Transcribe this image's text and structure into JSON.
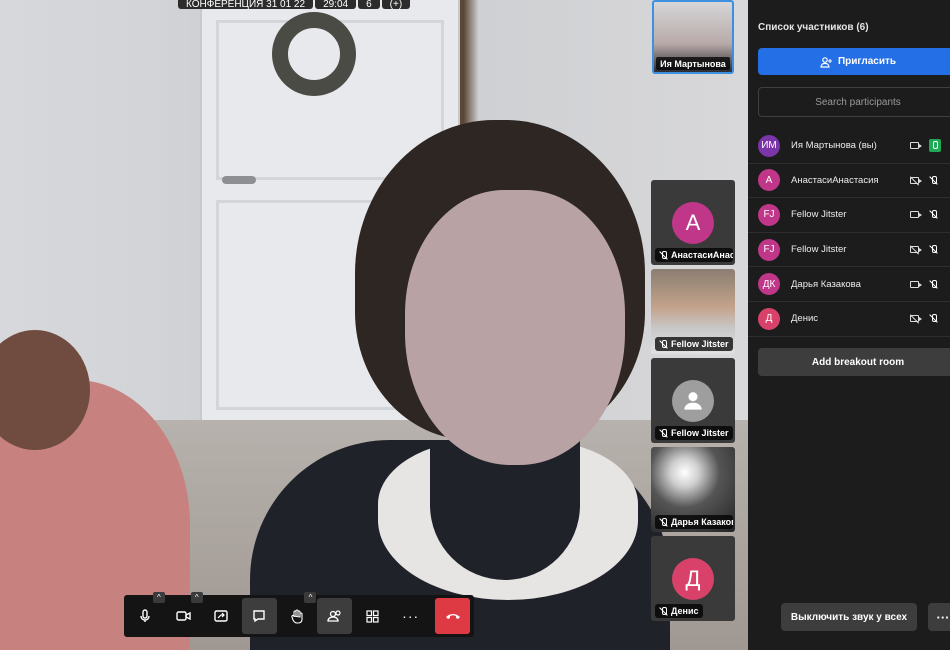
{
  "topbar": {
    "meeting_title": "КОНФЕРЕНЦИЯ 31 01 22",
    "timer": "29:04",
    "badge_count": "6",
    "extra": "(+)"
  },
  "self_view": {
    "name": "Ия Мартынова"
  },
  "filmstrip": [
    {
      "initial": "А",
      "name": "АнастасиАнастасия",
      "color": "#c0378a"
    },
    {
      "initial": "",
      "name": "Fellow Jitster",
      "color": "#888888"
    },
    {
      "initial": "",
      "name": "Fellow Jitster",
      "color": "#9e9e9e"
    },
    {
      "initial": "",
      "name": "Дарья Казакова",
      "color": "#666666"
    },
    {
      "initial": "Д",
      "name": "Денис",
      "color": "#d8426a"
    }
  ],
  "toolbar": {
    "buttons": [
      "mic",
      "camera",
      "share-screen",
      "chat",
      "raise-hand",
      "participants",
      "tile-view",
      "more",
      "hangup"
    ]
  },
  "panel": {
    "title": "Список участников (6)",
    "invite_label": "Пригласить",
    "search_placeholder": "Search participants",
    "participants": [
      {
        "initials": "ИМ",
        "name": "Ия Мартынова (вы)",
        "color": "#7a35a8",
        "camera": "on",
        "mic": "on"
      },
      {
        "initials": "А",
        "name": "АнастасиАнастасия",
        "color": "#c0378a",
        "camera": "off",
        "mic": "off"
      },
      {
        "initials": "FJ",
        "name": "Fellow Jitster",
        "color": "#c0378a",
        "camera": "on",
        "mic": "off"
      },
      {
        "initials": "FJ",
        "name": "Fellow Jitster",
        "color": "#c0378a",
        "camera": "off",
        "mic": "off"
      },
      {
        "initials": "ДК",
        "name": "Дарья Казакова",
        "color": "#c0378a",
        "camera": "on",
        "mic": "off"
      },
      {
        "initials": "Д",
        "name": "Денис",
        "color": "#d8426a",
        "camera": "off",
        "mic": "off"
      }
    ],
    "breakout_label": "Add breakout room",
    "mute_all_label": "Выключить звук у всех",
    "more_label": "···"
  },
  "colors": {
    "accent": "#246fe5",
    "hangup": "#dd3a44",
    "panel_bg": "#1c1c1c"
  }
}
